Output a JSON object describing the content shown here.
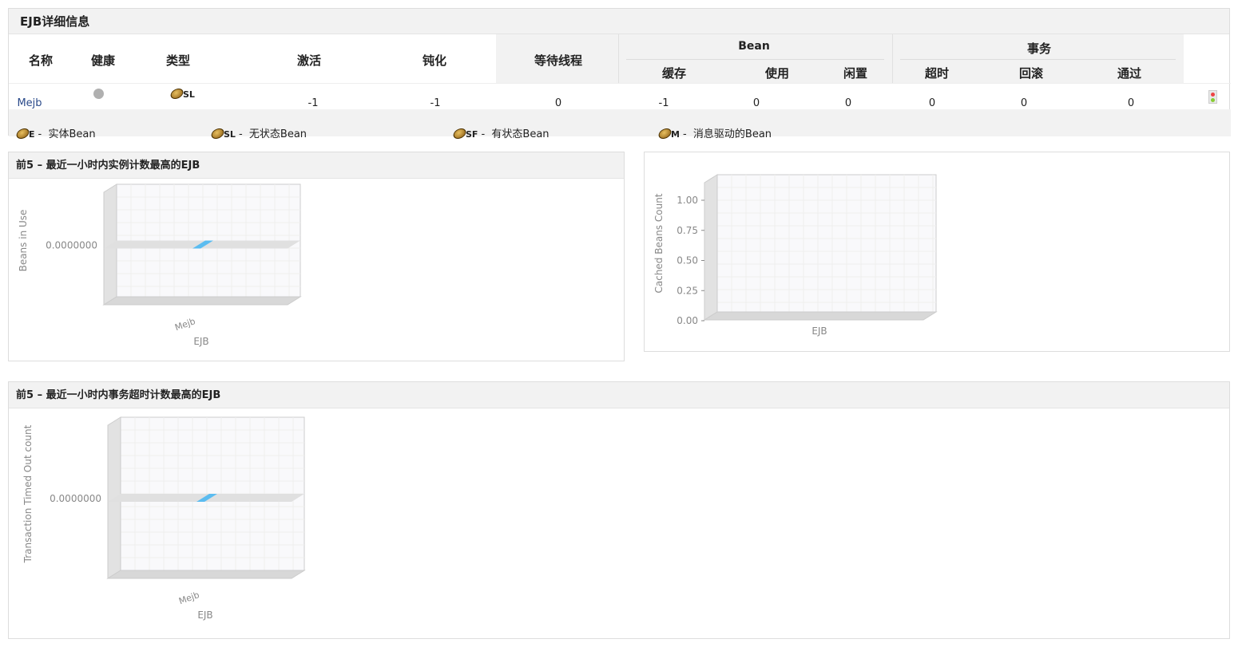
{
  "details": {
    "title": "EJB详细信息",
    "headers": {
      "name": "名称",
      "health": "健康",
      "type": "类型",
      "activated": "激活",
      "passivated": "钝化",
      "waiting_threads": "等待线程",
      "bean_group": "Bean",
      "cached": "缓存",
      "in_use": "使用",
      "idle": "闲置",
      "tx_group": "事务",
      "timeout": "超时",
      "rollback": "回滚",
      "commit": "通过"
    },
    "rows": [
      {
        "name": "Mejb",
        "health": "unknown",
        "type": "SL",
        "activated": "-1",
        "passivated": "-1",
        "waiting_threads": "0",
        "cached": "-1",
        "in_use": "0",
        "idle": "0",
        "timeout": "0",
        "rollback": "0",
        "commit": "0"
      }
    ],
    "legend": [
      {
        "code": "E",
        "label": "实体Bean"
      },
      {
        "code": "SL",
        "label": "无状态Bean"
      },
      {
        "code": "SF",
        "label": "有状态Bean"
      },
      {
        "code": "M",
        "label": "消息驱动的Bean"
      }
    ],
    "legend_sep": "-",
    "icons": {
      "bean": "bean-icon",
      "health": "gray-dot-icon",
      "action": "traffic-light-icon"
    }
  },
  "panels": {
    "instances_title": "前5 – 最近一小时内实例计数最高的EJB",
    "timeout_title": "前5 – 最近一小时内事务超时计数最高的EJB"
  },
  "colors": {
    "bar": "#5bbcf0",
    "health": "#b0b0b0"
  },
  "chart_data": [
    {
      "type": "bar",
      "categories": [
        "Mejb"
      ],
      "values": [
        0
      ],
      "xlabel": "EJB",
      "ylabel": "Beans in Use",
      "yticks": [
        "0.0000000"
      ],
      "grid": true,
      "style": "3d"
    },
    {
      "type": "bar",
      "categories": [],
      "values": [],
      "xlabel": "EJB",
      "ylabel": "Cached Beans Count",
      "yticks": [
        "0.00",
        "0.25",
        "0.50",
        "0.75",
        "1.00"
      ],
      "ylim": [
        0,
        1
      ],
      "grid": true,
      "style": "3d"
    },
    {
      "type": "bar",
      "categories": [
        "Mejb"
      ],
      "values": [
        0
      ],
      "xlabel": "EJB",
      "ylabel": "Transaction Timed Out count",
      "yticks": [
        "0.0000000"
      ],
      "grid": true,
      "style": "3d"
    }
  ]
}
